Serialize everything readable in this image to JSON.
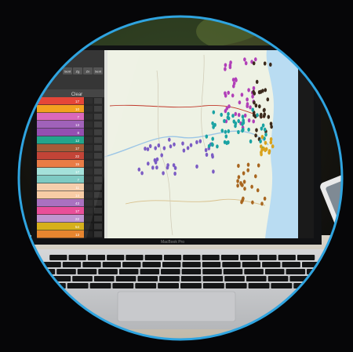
{
  "scene": {
    "laptop_label": "MacBook Pro",
    "background_color": "#060608",
    "ring_color": "#2fa4e0"
  },
  "app": {
    "toolbar": {
      "buttons": [
        "Sent",
        "Zg",
        "Zn",
        "Sent"
      ],
      "panel_header": "Clear"
    },
    "legend": {
      "rows": [
        {
          "color": "#e43b2c",
          "value": "17"
        },
        {
          "color": "#f39c12",
          "value": "10"
        },
        {
          "color": "#d85fb8",
          "value": "7"
        },
        {
          "color": "#9b59b6",
          "value": "13"
        },
        {
          "color": "#8e44ad",
          "value": "8"
        },
        {
          "color": "#16a085",
          "value": "12"
        },
        {
          "color": "#a0522d",
          "value": "17"
        },
        {
          "color": "#c0392b",
          "value": "22"
        },
        {
          "color": "#e8743b",
          "value": "15"
        },
        {
          "color": "#9fe0d8",
          "value": "17"
        },
        {
          "color": "#76c7c0",
          "value": "7"
        },
        {
          "color": "#f5cba7",
          "value": "11"
        },
        {
          "color": "#f8c9a0",
          "value": "14"
        },
        {
          "color": "#a569bd",
          "value": "43"
        },
        {
          "color": "#e84393",
          "value": "17"
        },
        {
          "color": "#bb8fce",
          "value": "22"
        },
        {
          "color": "#d4ac0d",
          "value": "54"
        },
        {
          "color": "#e67e22",
          "value": "13"
        }
      ]
    },
    "map": {
      "land_color": "#eef2e4",
      "water_color": "#b9dcf2",
      "marker_series": [
        {
          "color": "#b13fb8"
        },
        {
          "color": "#3b2a1c"
        },
        {
          "color": "#7b5cc4"
        },
        {
          "color": "#1aa3a3"
        },
        {
          "color": "#a8661f"
        },
        {
          "color": "#d9a21b"
        }
      ]
    }
  }
}
